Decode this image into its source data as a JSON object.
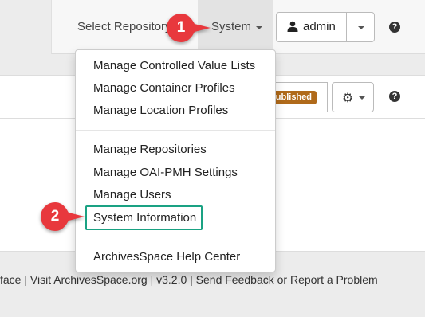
{
  "navbar": {
    "repo_label": "Select Repository",
    "system_label": "System",
    "admin_label": "admin",
    "help_symbol": "?"
  },
  "toolbar": {
    "published_label": "ublished",
    "help_symbol": "?"
  },
  "dropdown": {
    "items": [
      "Manage Controlled Value Lists",
      "Manage Container Profiles",
      "Manage Location Profiles",
      "Manage Repositories",
      "Manage OAI-PMH Settings",
      "Manage Users",
      "System Information",
      "ArchivesSpace Help Center"
    ]
  },
  "callouts": {
    "one": "1",
    "two": "2"
  },
  "footer": {
    "text": "face | Visit ArchivesSpace.org | v3.2.0 | Send Feedback or Report a Problem"
  },
  "colors": {
    "callout": "#e8383d",
    "highlight": "#1aa283",
    "badge": "#b06a1a"
  },
  "icons": [
    "user-icon",
    "caret-down-icon",
    "help-icon",
    "gear-icon"
  ]
}
